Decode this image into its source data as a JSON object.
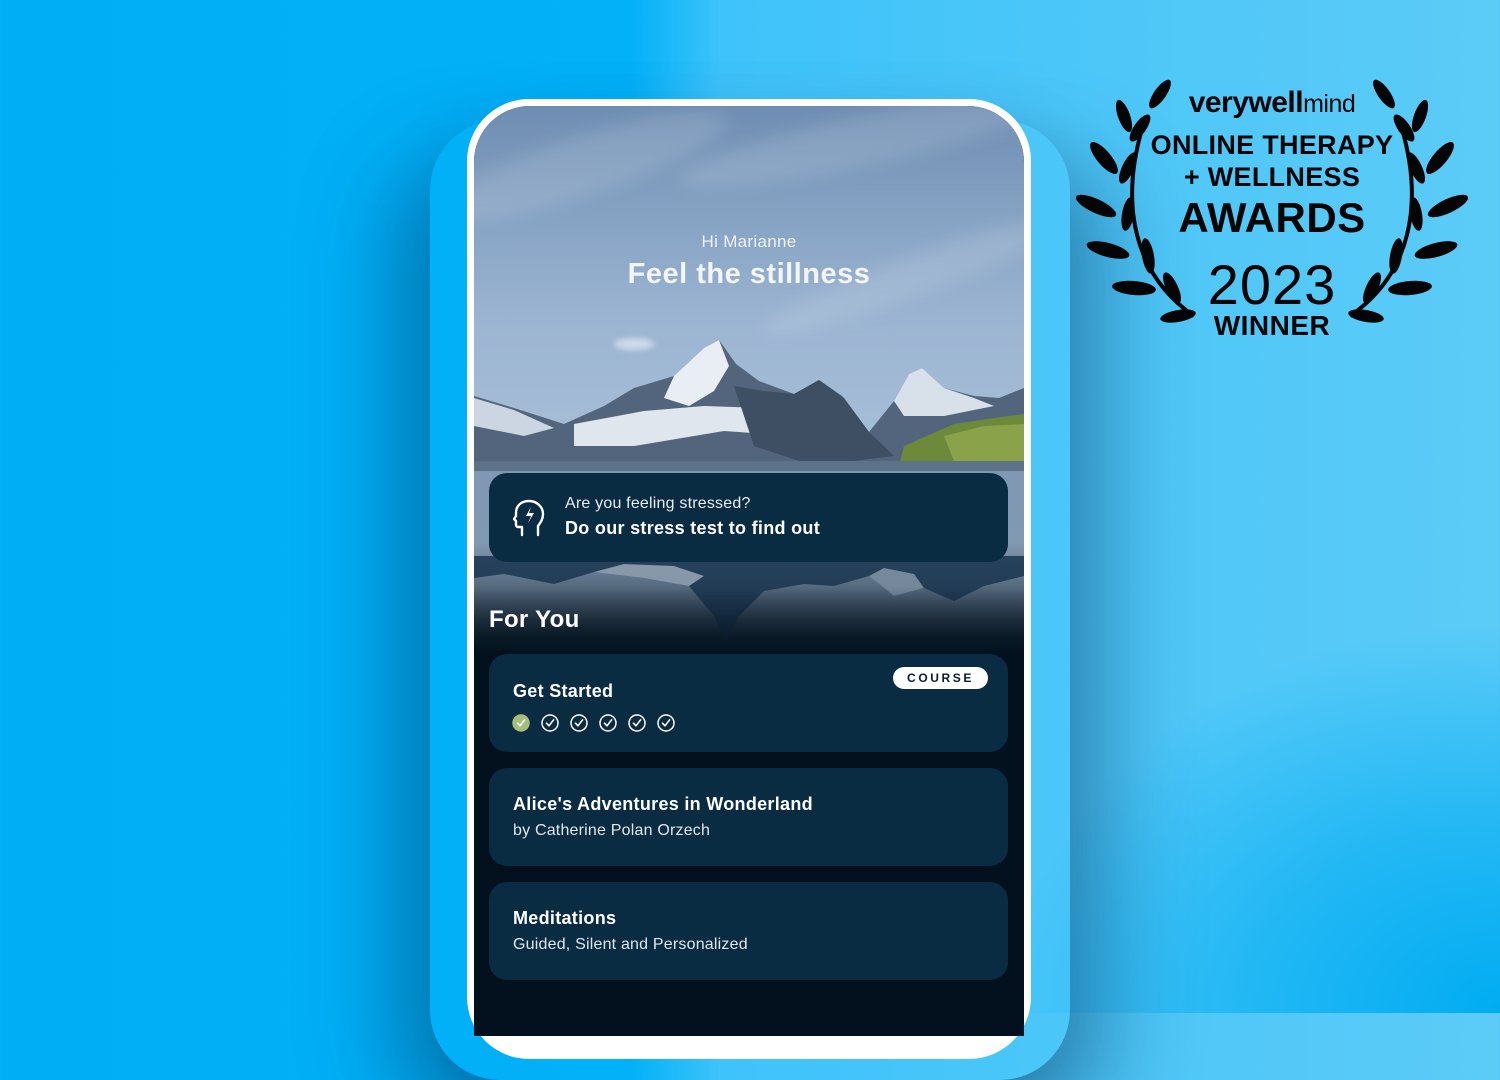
{
  "app": {
    "greeting": "Hi Marianne",
    "headline": "Feel the stillness",
    "stress_prompt": {
      "question": "Are you feeling stressed?",
      "cta": "Do our stress test to find out",
      "icon": "head-lightning-icon"
    },
    "section_title": "For You",
    "cards": [
      {
        "title": "Get Started",
        "badge": "COURSE",
        "progress": {
          "completed": 1,
          "total": 6
        },
        "step_icon": "check-circle-icon"
      },
      {
        "title": "Alice's Adventures in Wonderland",
        "subtitle": "by Catherine Polan Orzech"
      },
      {
        "title": "Meditations",
        "subtitle": "Guided, Silent and Personalized"
      }
    ]
  },
  "award": {
    "brand_bold": "verywell",
    "brand_light": "mind",
    "line1": "ONLINE THERAPY",
    "line2": "+ WELLNESS",
    "line3": "AWARDS",
    "year": "2023",
    "status": "WINNER",
    "icon": "laurel-wreath-icon"
  },
  "colors": {
    "background_blue": "#00aef6",
    "card": "#092c43",
    "screen_dark": "#02111d",
    "completed_step": "#a4bf78"
  }
}
